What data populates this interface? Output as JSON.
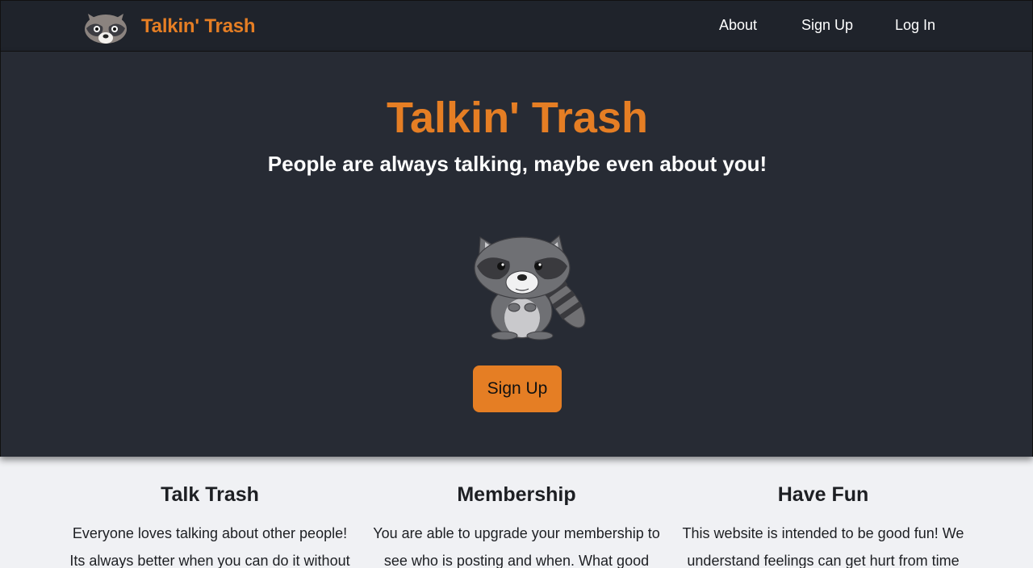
{
  "navbar": {
    "brand_name": "Talkin' Trash",
    "logo_icon": "raccoon-face-icon",
    "links": [
      {
        "label": "About"
      },
      {
        "label": "Sign Up"
      },
      {
        "label": "Log In"
      }
    ]
  },
  "hero": {
    "title": "Talkin' Trash",
    "subtitle": "People are always talking, maybe even about you!",
    "mascot_icon": "raccoon-mascot-icon",
    "cta_label": "Sign Up"
  },
  "features": [
    {
      "title": "Talk Trash",
      "text": "Everyone loves talking about other people! Its always better when you can do it without"
    },
    {
      "title": "Membership",
      "text": "You are able to upgrade your membership to see who is posting and when. What good"
    },
    {
      "title": "Have Fun",
      "text": "This website is intended to be good fun! We understand feelings can get hurt from time"
    }
  ],
  "colors": {
    "accent": "#e57e24",
    "nav_bg": "#1f232b",
    "hero_bg": "#272b34",
    "page_bg": "#f0f1f4"
  }
}
